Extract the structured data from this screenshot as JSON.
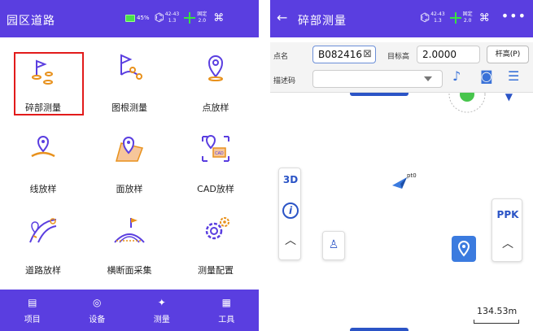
{
  "left": {
    "header": {
      "title": "园区道路",
      "battery_percent": "45%",
      "satellites": "42-43",
      "satellites_sub": "1.3",
      "fix_status": "固定",
      "fix_value": "2.0"
    },
    "menu": [
      {
        "label": "碎部测量",
        "icon": "survey-flag-icon",
        "selected": true
      },
      {
        "label": "图根测量",
        "icon": "control-point-icon",
        "selected": false
      },
      {
        "label": "点放样",
        "icon": "point-stakeout-icon",
        "selected": false
      },
      {
        "label": "线放样",
        "icon": "line-stakeout-icon",
        "selected": false
      },
      {
        "label": "面放样",
        "icon": "area-stakeout-icon",
        "selected": false
      },
      {
        "label": "CAD放样",
        "icon": "cad-stakeout-icon",
        "selected": false
      },
      {
        "label": "道路放样",
        "icon": "road-stakeout-icon",
        "selected": false
      },
      {
        "label": "横断面采集",
        "icon": "cross-section-icon",
        "selected": false
      },
      {
        "label": "测量配置",
        "icon": "settings-gear-icon",
        "selected": false
      }
    ],
    "nav": [
      {
        "label": "项目",
        "icon": "project-icon",
        "active": false
      },
      {
        "label": "设备",
        "icon": "device-icon",
        "active": false
      },
      {
        "label": "测量",
        "icon": "measure-icon",
        "active": true
      },
      {
        "label": "工具",
        "icon": "tools-icon",
        "active": false
      }
    ]
  },
  "right": {
    "header": {
      "title": "碎部测量",
      "satellites": "42-43",
      "satellites_sub": "1.3",
      "fix_status": "固定",
      "fix_value": "2.0"
    },
    "form": {
      "point_name_label": "点名",
      "point_name_value": "B082416",
      "target_height_label": "目标高",
      "target_height_value": "2.0000",
      "pole_button": "杆高(P)",
      "code_label": "描述码",
      "code_value": ""
    },
    "map": {
      "btn_3d": "3D",
      "info": "i",
      "point_label": "pt0",
      "ppk": "PPK",
      "scale": "134.53m"
    }
  }
}
